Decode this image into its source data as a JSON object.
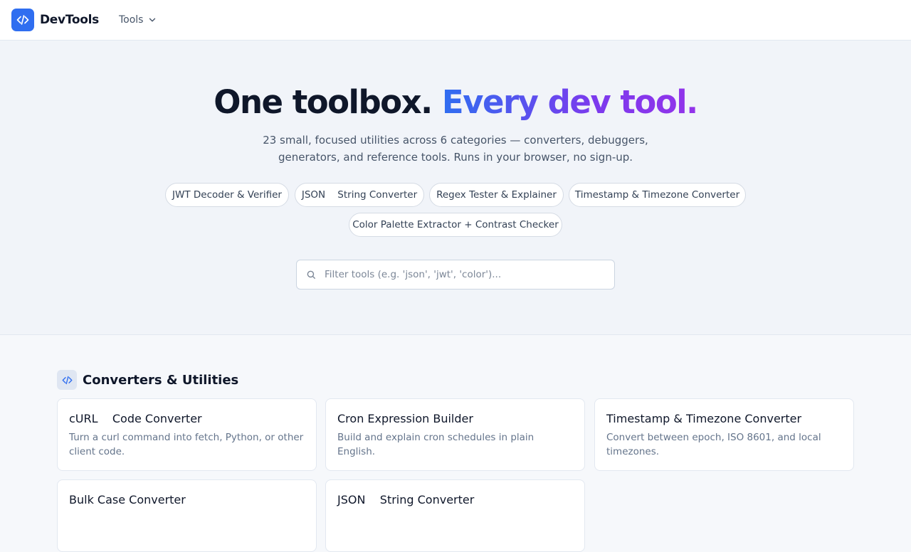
{
  "nav": {
    "brand": "DevTools",
    "tools_menu": "Tools",
    "logo_icon": "code-icon",
    "menu_icon": "chevron-down-icon"
  },
  "hero": {
    "headline_plain": "One toolbox.",
    "headline_accent": "Every dev tool.",
    "subtitle": "23 small, focused utilities across 6 categories — converters, debuggers, generators, and reference tools. Runs in your browser, no sign-up.",
    "featured": [
      "JWT Decoder & Verifier",
      "JSON    String Converter",
      "Regex Tester & Explainer",
      "Timestamp & Timezone Converter",
      "Color Palette Extractor + Contrast Checker"
    ]
  },
  "search": {
    "placeholder": "Filter tools (e.g. 'json', 'jwt', 'color')...",
    "value": "",
    "icon": "search-icon"
  },
  "section": {
    "title": "Converters & Utilities",
    "icon": "code-icon",
    "cards": [
      {
        "title": "cURL    Code Converter",
        "desc": "Turn a curl command into fetch, Python, or other client code."
      },
      {
        "title": "Cron Expression Builder",
        "desc": "Build and explain cron schedules in plain English."
      },
      {
        "title": "Timestamp & Timezone Converter",
        "desc": "Convert between epoch, ISO 8601, and local timezones."
      },
      {
        "title": "Bulk Case Converter",
        "desc": ""
      },
      {
        "title": "JSON    String Converter",
        "desc": ""
      }
    ]
  },
  "colors": {
    "accent": "#2f6ef0",
    "gradient_end": "#9333ea",
    "text": "#0f172a",
    "muted": "#64748b"
  }
}
